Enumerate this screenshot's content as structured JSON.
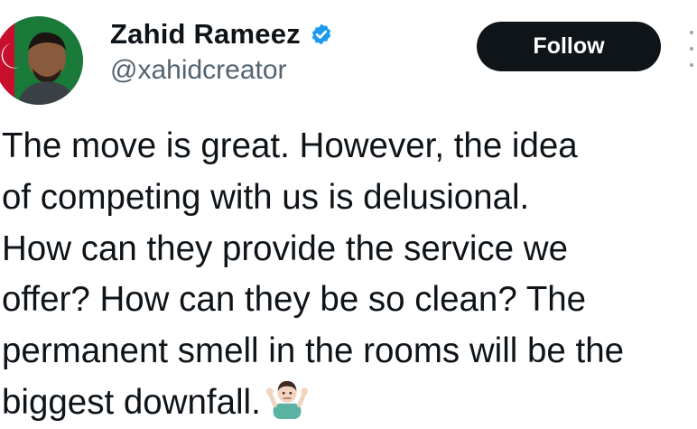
{
  "tweet": {
    "author_name": "Zahid Rameez",
    "author_handle": "@xahidcreator",
    "verified": true,
    "follow_label": "Follow",
    "text": "The move is great. However, the idea\nof competing with us is delusional.\nHow can they provide the service we\noffer? How can they be so clean? The\npermanent smell in the rooms will be the\nbiggest downfall.",
    "emoji": "person-shrugging-emoji"
  },
  "colors": {
    "verified_badge": "#1d9bf0",
    "follow_button": "#0f1419",
    "handle_text": "#536471"
  }
}
